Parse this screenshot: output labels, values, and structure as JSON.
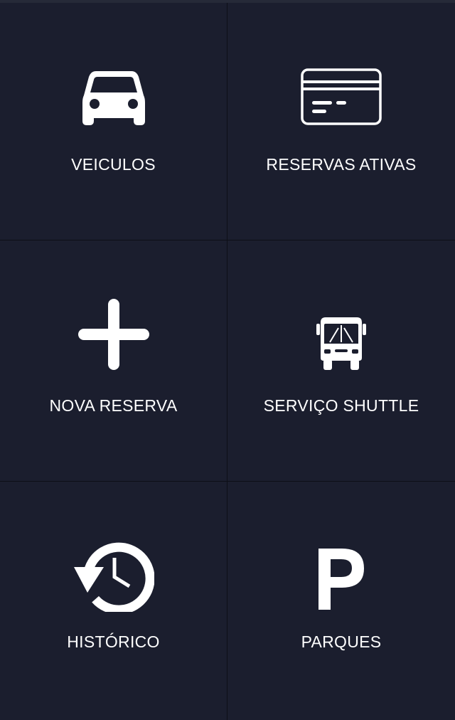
{
  "menu": {
    "items": [
      {
        "label": "VEICULOS",
        "icon": "car-icon"
      },
      {
        "label": "RESERVAS ATIVAS",
        "icon": "credit-card-icon"
      },
      {
        "label": "NOVA RESERVA",
        "icon": "plus-icon"
      },
      {
        "label": "SERVIÇO SHUTTLE",
        "icon": "bus-icon"
      },
      {
        "label": "HISTÓRICO",
        "icon": "history-icon"
      },
      {
        "label": "PARQUES",
        "icon": "parking-icon"
      }
    ]
  },
  "colors": {
    "background": "#1b1e2e",
    "divider": "#0d0f17",
    "foreground": "#ffffff"
  }
}
